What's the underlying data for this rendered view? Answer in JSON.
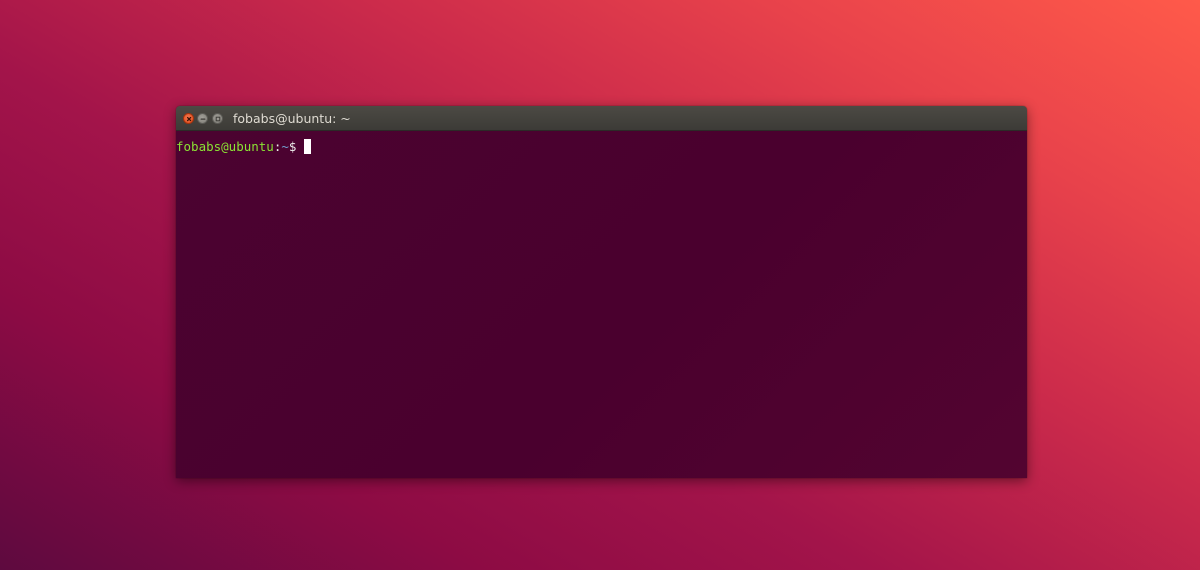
{
  "window": {
    "title": "fobabs@ubuntu: ~"
  },
  "controls": {
    "close_icon": "close-icon",
    "minimize_icon": "minimize-icon",
    "maximize_icon": "maximize-icon"
  },
  "terminal": {
    "prompt_user": "fobabs@ubuntu",
    "prompt_separator": ":",
    "prompt_path": "~",
    "prompt_symbol": "$",
    "input": ""
  },
  "colors": {
    "prompt_user": "#8ae234",
    "prompt_path": "#729fcf",
    "terminal_background": "#4a002e",
    "close_button": "#df4a16"
  }
}
